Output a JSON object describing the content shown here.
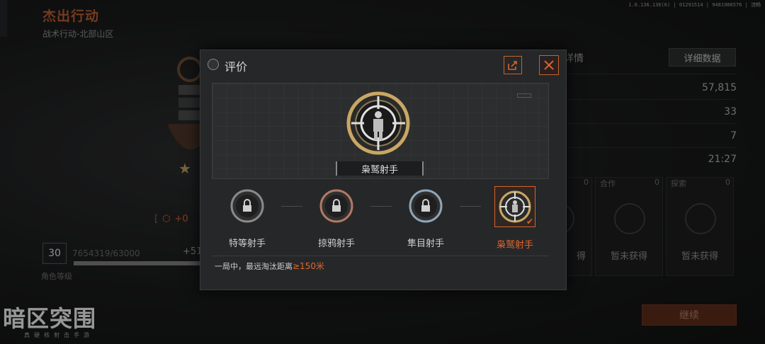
{
  "version": "1.0.136.136(6) | 01291514 | 9481986576 | 流畅",
  "header": {
    "title": "杰出行动",
    "subtitle": "战术行动-北部山区"
  },
  "player": {
    "level": "30",
    "exp_text": "7654319/63000",
    "exp_gain": "+51",
    "level_label": "角色等级",
    "plus_value": "+0"
  },
  "right_panel": {
    "title": "详情",
    "detail_button": "详细数据",
    "stats": [
      "57,815",
      "33",
      "7",
      "21:27"
    ],
    "achievements": [
      {
        "label": "",
        "count": "0",
        "status": "得"
      },
      {
        "label": "合作",
        "count": "0",
        "status": "暂未获得"
      },
      {
        "label": "探索",
        "count": "0",
        "status": "暂未获得"
      }
    ],
    "continue_button": "继续"
  },
  "logo": {
    "main": "暗区突围",
    "tagline": "真硬核射击手游"
  },
  "modal": {
    "title": "评价",
    "hero_name": "枭鹫射手",
    "tiers": [
      {
        "label": "特等射手",
        "ring": "#8a8a8a",
        "active": false
      },
      {
        "label": "掠鸦射手",
        "ring": "#b07a64",
        "active": false
      },
      {
        "label": "隼目射手",
        "ring": "#8fa6b8",
        "active": false
      },
      {
        "label": "枭鹫射手",
        "ring": "#c9a763",
        "active": true
      }
    ],
    "desc_prefix": "一局中，最远淘汰距离",
    "desc_value": "≥150米"
  },
  "colors": {
    "accent": "#e2662c",
    "gold": "#c9a763"
  },
  "icons": {
    "share": "share-icon",
    "close": "close-icon",
    "lock": "lock-icon"
  }
}
